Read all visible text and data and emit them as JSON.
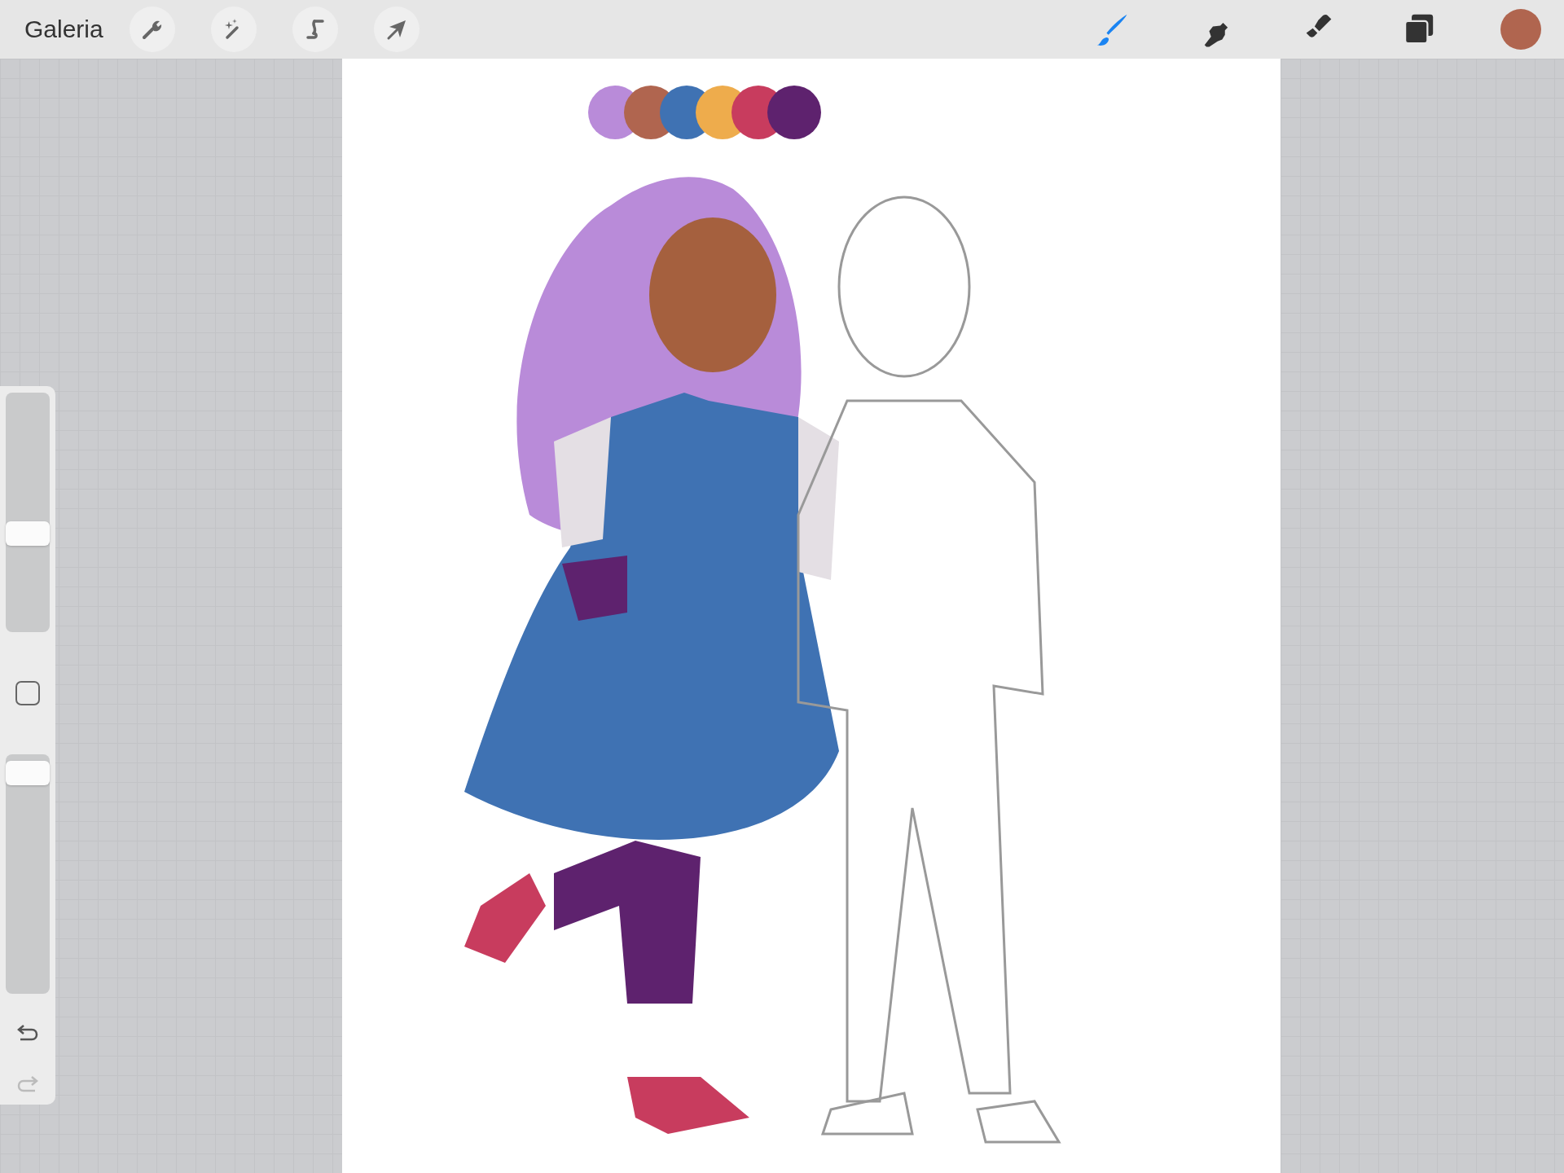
{
  "toolbar": {
    "gallery": "Galeria",
    "actions": [
      {
        "kind": "wrench"
      },
      {
        "kind": "wand"
      },
      {
        "kind": "selection"
      },
      {
        "kind": "transform"
      }
    ],
    "tools": [
      {
        "kind": "brush",
        "selected": true
      },
      {
        "kind": "smudge",
        "selected": false
      },
      {
        "kind": "eraser",
        "selected": false
      },
      {
        "kind": "layers",
        "selected": false
      }
    ],
    "color": "#b0654f"
  },
  "sidebar": {
    "brush_size": {
      "level": 0.4
    },
    "opacity": {
      "level": 0.97
    },
    "undo": {
      "disabled": false
    },
    "redo": {
      "disabled": true
    }
  }
}
